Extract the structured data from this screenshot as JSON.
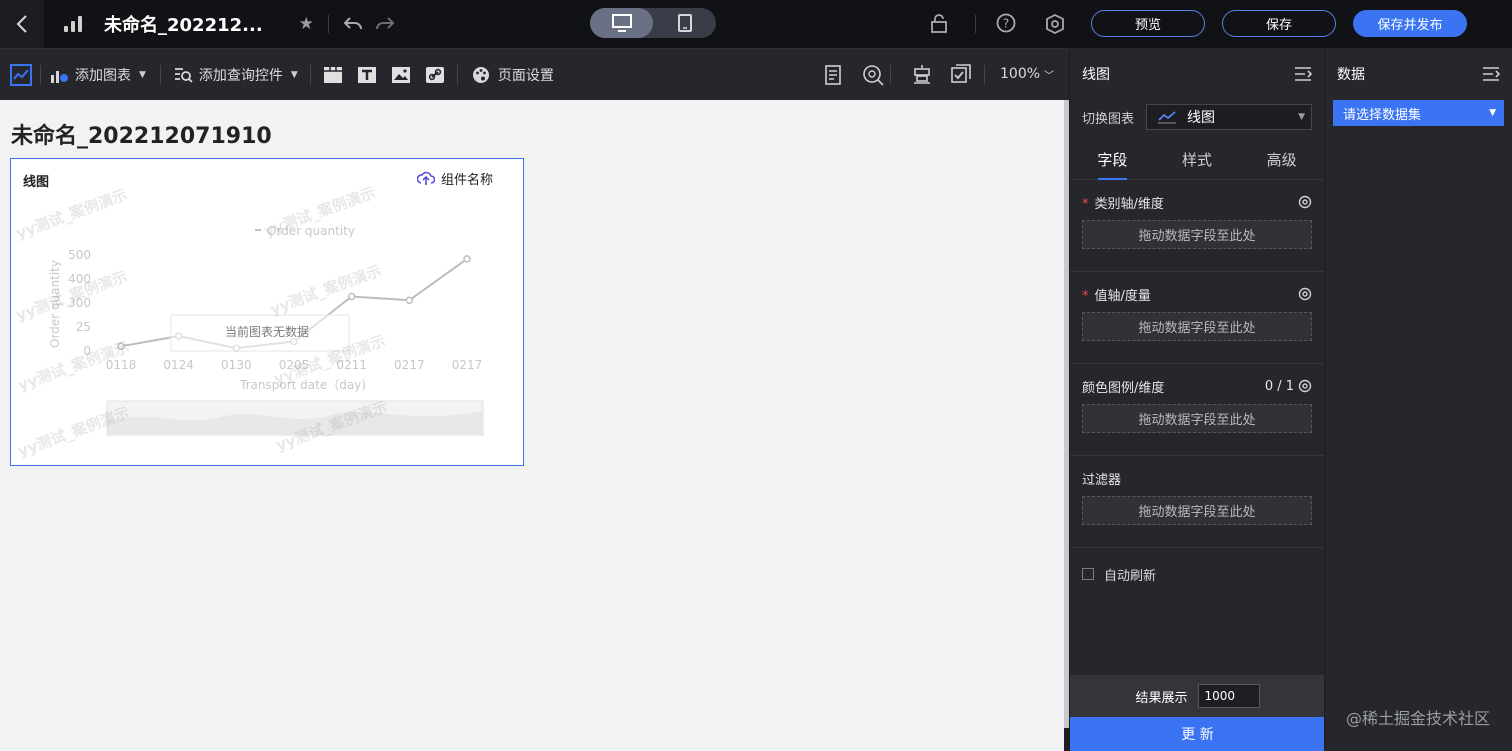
{
  "topbar": {
    "title": "未命名_202212...",
    "preview_label": "预览",
    "save_label": "保存",
    "save_publish_label": "保存并发布"
  },
  "toolbar": {
    "add_chart_label": "添加图表",
    "add_query_label": "添加查询控件",
    "page_settings_label": "页面设置",
    "zoom_label": "100%"
  },
  "canvas": {
    "page_title": "未命名_202212071910",
    "chart_card": {
      "title": "线图",
      "component_name_label": "组件名称",
      "empty_text": "当前图表无数据",
      "watermark": "yy测试_案例演示"
    }
  },
  "chart_data": {
    "type": "line",
    "title": "",
    "legend": [
      "Order quantity"
    ],
    "xlabel": "Transport date（day)",
    "ylabel": "Order quantity",
    "categories": [
      "0118",
      "0124",
      "0130",
      "0205",
      "0211",
      "0217",
      "0217"
    ],
    "y_ticks": [
      "500",
      "400",
      "300",
      "25",
      "0"
    ],
    "series": [
      {
        "name": "Order quantity",
        "values": [
          25,
          80,
          15,
          50,
          290,
          270,
          490
        ]
      }
    ],
    "grid": false,
    "legend_placement": "top-center"
  },
  "settings_panel": {
    "title": "线图",
    "switch_chart_label": "切换图表",
    "chart_type_value": "线图",
    "tabs": [
      {
        "label": "字段"
      },
      {
        "label": "样式"
      },
      {
        "label": "高级"
      }
    ],
    "fields": [
      {
        "label": "类别轴/维度",
        "required": "*",
        "drop_hint": "拖动数据字段至此处",
        "count": ""
      },
      {
        "label": "值轴/度量",
        "required": "*",
        "drop_hint": "拖动数据字段至此处",
        "count": ""
      },
      {
        "label": "颜色图例/维度",
        "required": "",
        "drop_hint": "拖动数据字段至此处",
        "count": "0 / 1"
      },
      {
        "label": "过滤器",
        "required": "",
        "drop_hint": "拖动数据字段至此处",
        "count": ""
      }
    ],
    "auto_refresh_label": "自动刷新",
    "result_label": "结果展示",
    "result_value": "1000",
    "update_label": "更 新"
  },
  "data_panel": {
    "title": "数据",
    "dataset_placeholder": "请选择数据集"
  },
  "footer_watermark": "@稀土掘金技术社区",
  "colors": {
    "accent": "#3b74f2",
    "topbar_bg": "#111216",
    "panel_bg": "#26272c",
    "canvas_bg": "#f1f2f4"
  }
}
